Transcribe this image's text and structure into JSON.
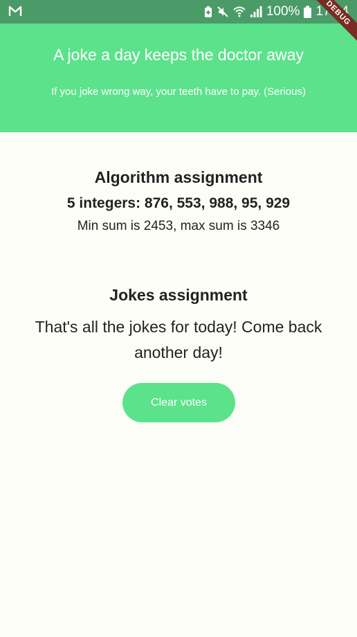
{
  "status_bar": {
    "battery_percent": "100%",
    "time": "17:54",
    "icons": [
      "gmail-icon",
      "battery-saver-icon",
      "mute-icon",
      "wifi-icon",
      "signal-icon",
      "battery-icon"
    ]
  },
  "debug_banner": "DEBUG",
  "header": {
    "title": "A joke a day keeps the doctor away",
    "subtitle": "If you joke wrong way, your teeth have to pay. (Serious)"
  },
  "algorithm": {
    "title": "Algorithm assignment",
    "integers": "5 integers: 876, 553, 988, 95, 929",
    "result": "Min sum is 2453, max sum is 3346"
  },
  "jokes": {
    "title": "Jokes assignment",
    "message": "That's all the jokes for today! Come back another day!"
  },
  "clear_button": {
    "label": "Clear votes"
  },
  "colors": {
    "status_bar": "#4a9b68",
    "accent": "#5de28c",
    "background": "#fdfdf8",
    "text": "#222222",
    "debug": "#7a2c22"
  }
}
